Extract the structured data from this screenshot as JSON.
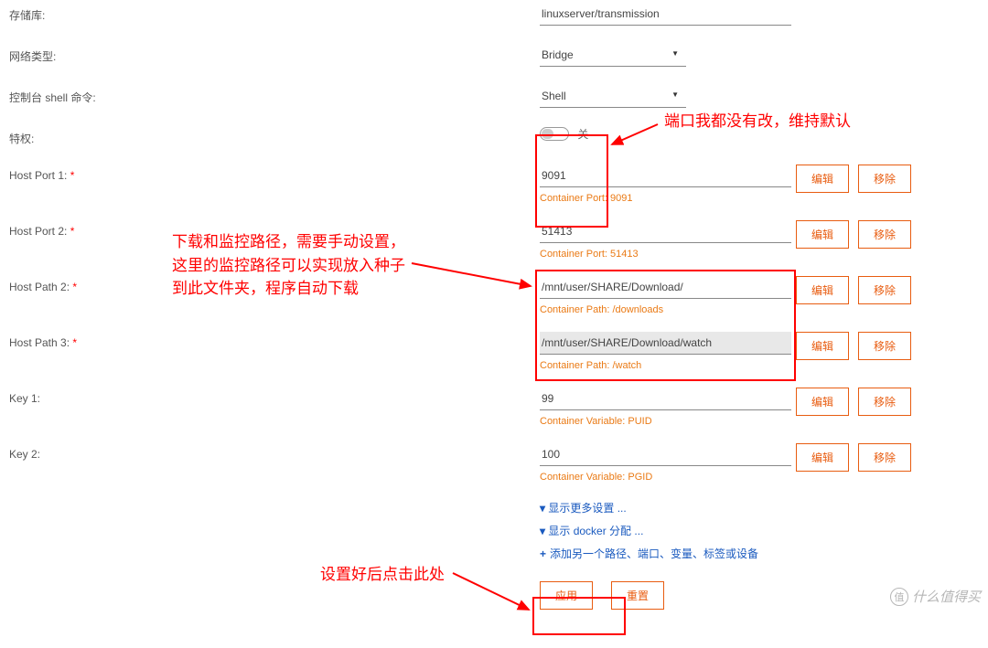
{
  "rows": {
    "repo": {
      "label": "存储库:",
      "value": "linuxserver/transmission"
    },
    "network": {
      "label": "网络类型:",
      "value": "Bridge"
    },
    "shell": {
      "label": "控制台 shell 命令:",
      "value": "Shell"
    },
    "priv": {
      "label": "特权:",
      "toggle": "关"
    },
    "hostport1": {
      "label": "Host Port 1:",
      "value": "9091",
      "helper": "Container Port: 9091"
    },
    "hostport2": {
      "label": "Host Port 2:",
      "value": "51413",
      "helper": "Container Port: 51413"
    },
    "hostpath2": {
      "label": "Host Path 2:",
      "value": "/mnt/user/SHARE/Download/",
      "helper": "Container Path: /downloads"
    },
    "hostpath3": {
      "label": "Host Path 3:",
      "value": "/mnt/user/SHARE/Download/watch",
      "helper": "Container Path: /watch"
    },
    "key1": {
      "label": "Key 1:",
      "value": "99",
      "helper": "Container Variable: PUID"
    },
    "key2": {
      "label": "Key 2:",
      "value": "100",
      "helper": "Container Variable: PGID"
    }
  },
  "buttons": {
    "edit": "编辑",
    "remove": "移除",
    "apply": "应用",
    "reset": "重置"
  },
  "links": {
    "show_more": "显示更多设置 ...",
    "show_docker": "显示 docker 分配 ...",
    "add_another": "添加另一个路径、端口、变量、标签或设备"
  },
  "annotations": {
    "a1": "端口我都没有改，维持默认",
    "a2": "下载和监控路径，需要手动设置，\n这里的监控路径可以实现放入种子\n到此文件夹，程序自动下载",
    "a3": "设置好后点击此处"
  },
  "watermark": "什么值得买"
}
